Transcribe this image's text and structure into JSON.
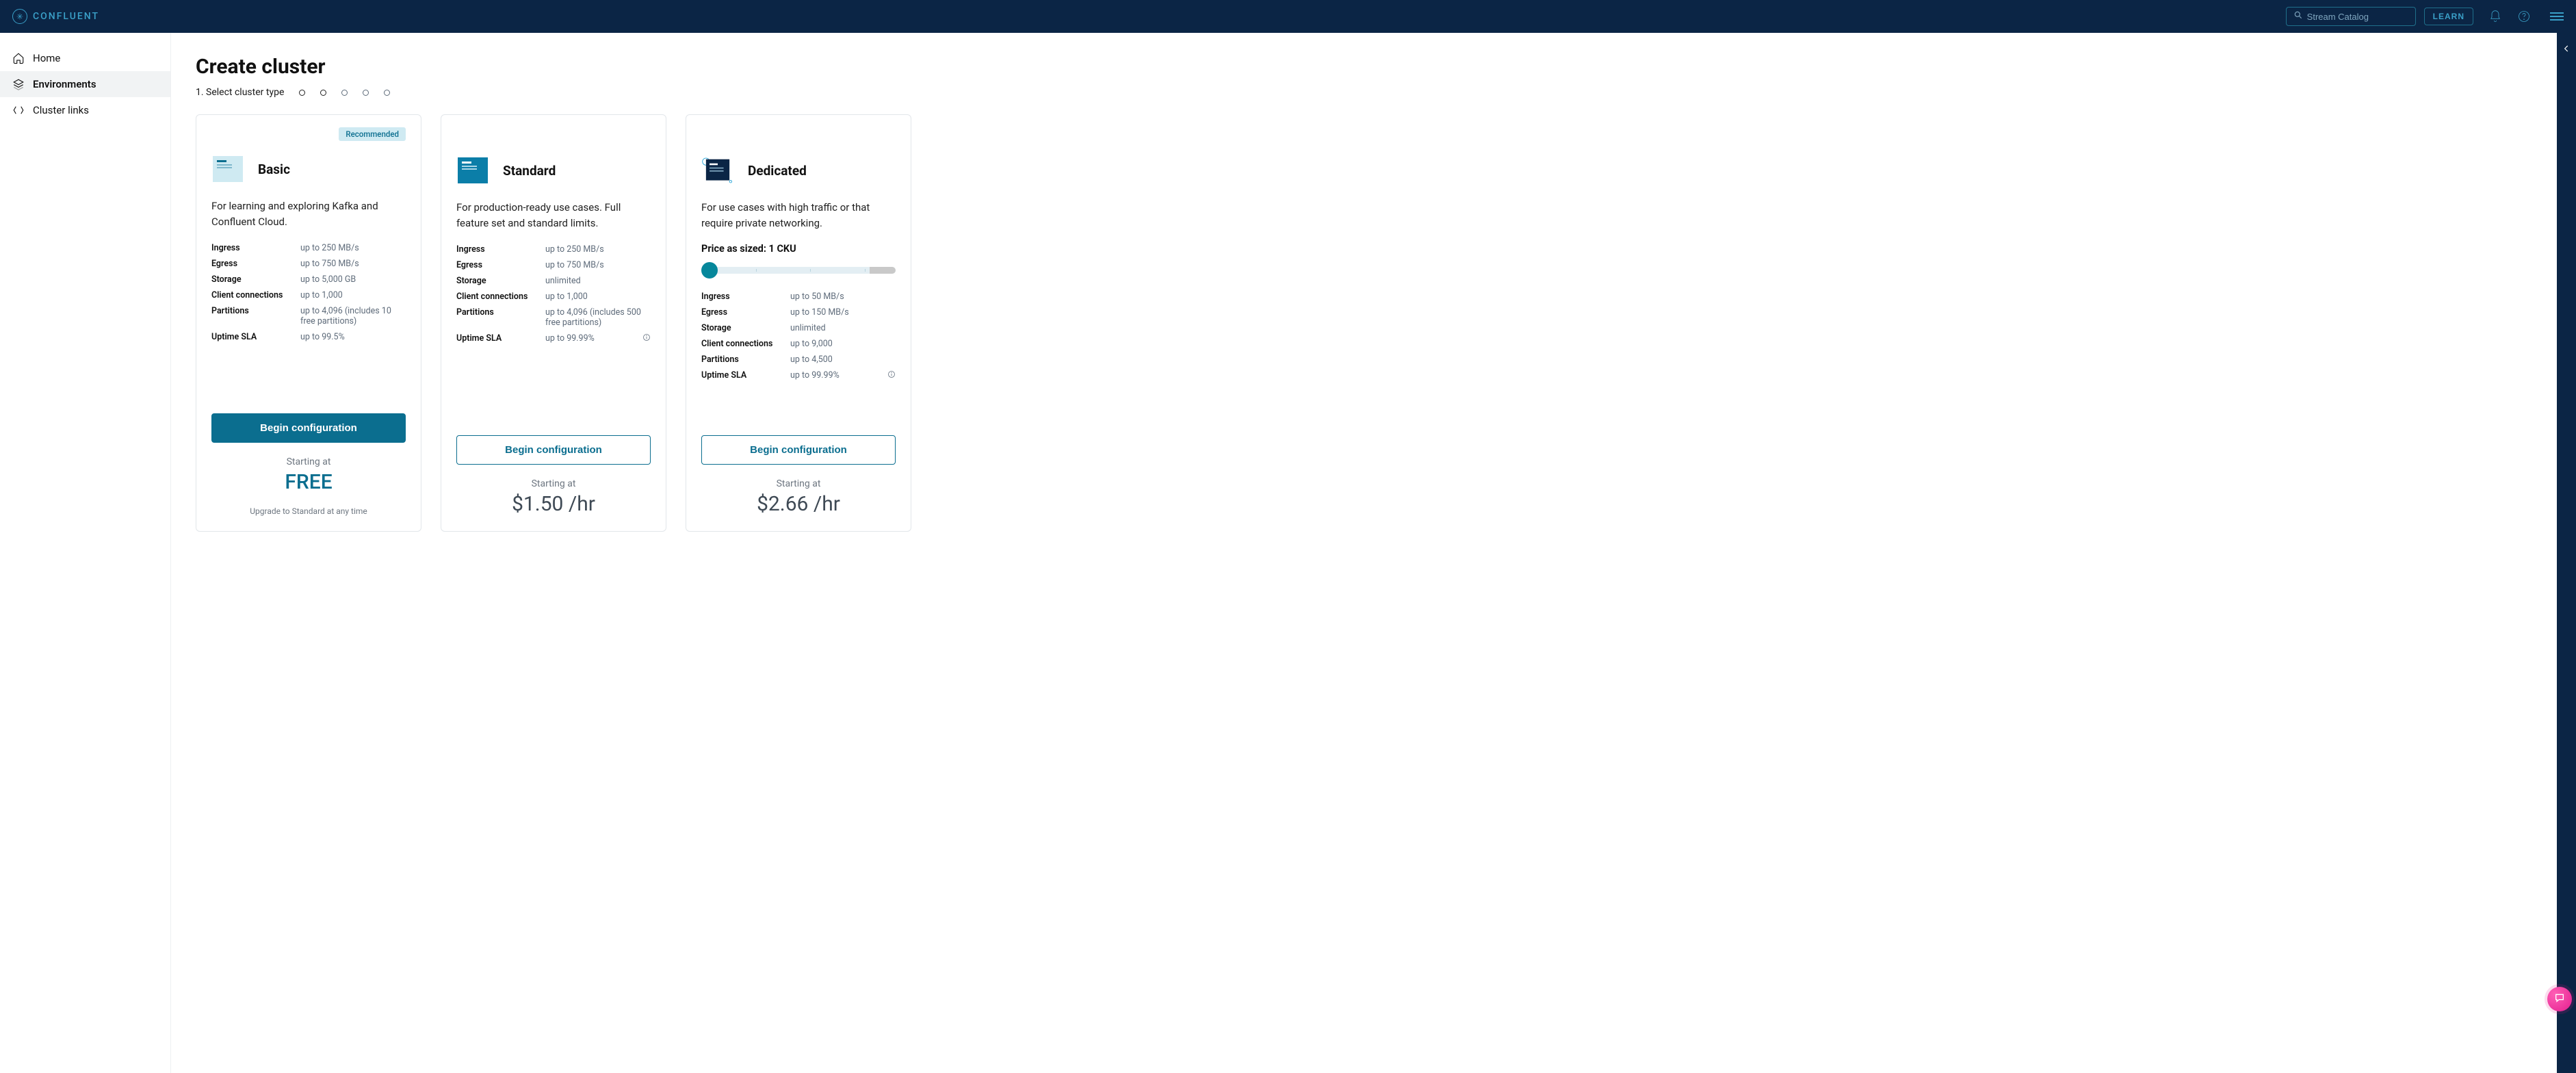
{
  "brand": "CONFLUENT",
  "search": {
    "placeholder": "Stream Catalog"
  },
  "learn_label": "LEARN",
  "sidebar": {
    "items": [
      {
        "label": "Home"
      },
      {
        "label": "Environments"
      },
      {
        "label": "Cluster links"
      }
    ]
  },
  "page": {
    "title": "Create cluster",
    "step_label": "1. Select cluster type"
  },
  "cards": [
    {
      "name": "Basic",
      "badge": "Recommended",
      "desc": "For learning and exploring Kafka and Confluent Cloud.",
      "specs": [
        {
          "label": "Ingress",
          "value": "up to 250 MB/s"
        },
        {
          "label": "Egress",
          "value": "up to 750 MB/s"
        },
        {
          "label": "Storage",
          "value": "up to 5,000 GB"
        },
        {
          "label": "Client connections",
          "value": "up to 1,000"
        },
        {
          "label": "Partitions",
          "value": "up to 4,096 (includes 10 free partitions)"
        },
        {
          "label": "Uptime SLA",
          "value": "up to 99.5%"
        }
      ],
      "button": "Begin configuration",
      "starting_label": "Starting at",
      "price": "FREE",
      "note": "Upgrade to Standard at any time"
    },
    {
      "name": "Standard",
      "desc": "For production-ready use cases. Full feature set and standard limits.",
      "specs": [
        {
          "label": "Ingress",
          "value": "up to 250 MB/s"
        },
        {
          "label": "Egress",
          "value": "up to 750 MB/s"
        },
        {
          "label": "Storage",
          "value": "unlimited"
        },
        {
          "label": "Client connections",
          "value": "up to 1,000"
        },
        {
          "label": "Partitions",
          "value": "up to 4,096 (includes 500 free partitions)"
        },
        {
          "label": "Uptime SLA",
          "value": "up to 99.99%"
        }
      ],
      "button": "Begin configuration",
      "starting_label": "Starting at",
      "price": "$1.50 /hr"
    },
    {
      "name": "Dedicated",
      "desc": "For use cases with high traffic or that require private networking.",
      "cku_label": "Price as sized: 1 CKU",
      "specs": [
        {
          "label": "Ingress",
          "value": "up to 50 MB/s"
        },
        {
          "label": "Egress",
          "value": "up to 150 MB/s"
        },
        {
          "label": "Storage",
          "value": "unlimited"
        },
        {
          "label": "Client connections",
          "value": "up to 9,000"
        },
        {
          "label": "Partitions",
          "value": "up to 4,500"
        },
        {
          "label": "Uptime SLA",
          "value": "up to 99.99%"
        }
      ],
      "button": "Begin configuration",
      "starting_label": "Starting at",
      "price": "$2.66 /hr"
    }
  ]
}
